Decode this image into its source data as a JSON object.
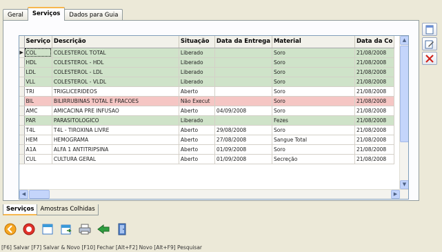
{
  "top_tabs": [
    "Geral",
    "Serviços",
    "Dados para Guia"
  ],
  "grid": {
    "columns": [
      "Serviço",
      "Descrição",
      "Situação",
      "Data da Entrega",
      "Material",
      "Data da Co"
    ],
    "rows": [
      {
        "code": "COL",
        "desc": "COLESTEROL TOTAL",
        "situacao": "Liberado",
        "data_entrega": "",
        "material": "Soro",
        "data_coleta": "21/08/2008",
        "color": "green",
        "selected": true
      },
      {
        "code": "HDL",
        "desc": "COLESTEROL - HDL",
        "situacao": "Liberado",
        "data_entrega": "",
        "material": "Soro",
        "data_coleta": "21/08/2008",
        "color": "green"
      },
      {
        "code": "LDL",
        "desc": "COLESTEROL - LDL",
        "situacao": "Liberado",
        "data_entrega": "",
        "material": "Soro",
        "data_coleta": "21/08/2008",
        "color": "green"
      },
      {
        "code": "VLL",
        "desc": "COLESTEROL - VLDL",
        "situacao": "Liberado",
        "data_entrega": "",
        "material": "Soro",
        "data_coleta": "21/08/2008",
        "color": "green"
      },
      {
        "code": "TRI",
        "desc": "TRIGLICERIDEOS",
        "situacao": "Aberto",
        "data_entrega": "",
        "material": "Soro",
        "data_coleta": "21/08/2008",
        "color": "white"
      },
      {
        "code": "BIL",
        "desc": "BILIRRUBINAS TOTAL E FRACOES",
        "situacao": "Não Execut",
        "data_entrega": "",
        "material": "Soro",
        "data_coleta": "21/08/2008",
        "color": "red"
      },
      {
        "code": "AMC",
        "desc": "AMICACINA PRE INFUSAO",
        "situacao": "Aberto",
        "data_entrega": "04/09/2008",
        "material": "Soro",
        "data_coleta": "21/08/2008",
        "color": "white"
      },
      {
        "code": "PAR",
        "desc": "PARASITOLOGICO",
        "situacao": "Liberado",
        "data_entrega": "",
        "material": "Fezes",
        "data_coleta": "21/08/2008",
        "color": "green"
      },
      {
        "code": "T4L",
        "desc": "T4L - TIROXINA LIVRE",
        "situacao": "Aberto",
        "data_entrega": "29/08/2008",
        "material": "Soro",
        "data_coleta": "21/08/2008",
        "color": "white"
      },
      {
        "code": "HEM",
        "desc": "HEMOGRAMA",
        "situacao": "Aberto",
        "data_entrega": "27/08/2008",
        "material": "Sangue Total",
        "data_coleta": "21/08/2008",
        "color": "white"
      },
      {
        "code": "A1A",
        "desc": "ALFA 1 ANTITRIPSINA",
        "situacao": "Aberto",
        "data_entrega": "01/09/2008",
        "material": "Soro",
        "data_coleta": "21/08/2008",
        "color": "white"
      },
      {
        "code": "CUL",
        "desc": "CULTURA GERAL",
        "situacao": "Aberto",
        "data_entrega": "01/09/2008",
        "material": "Secreção",
        "data_coleta": "21/08/2008",
        "color": "white"
      }
    ]
  },
  "bottom_tabs": [
    "Serviços",
    "Amostras Colhidas"
  ],
  "status_bar": "[F6] Salvar [F7] Salvar & Novo [F10] Fechar         [Alt+F2] Novo [Alt+F9] Pesquisar",
  "side_buttons": [
    "new-document-icon",
    "edit-icon",
    "delete-icon"
  ],
  "toolbar_icons": [
    "back-icon",
    "stop-icon",
    "open-document-icon",
    "move-document-icon",
    "print-icon",
    "arrow-green-icon",
    "exit-door-icon"
  ]
}
